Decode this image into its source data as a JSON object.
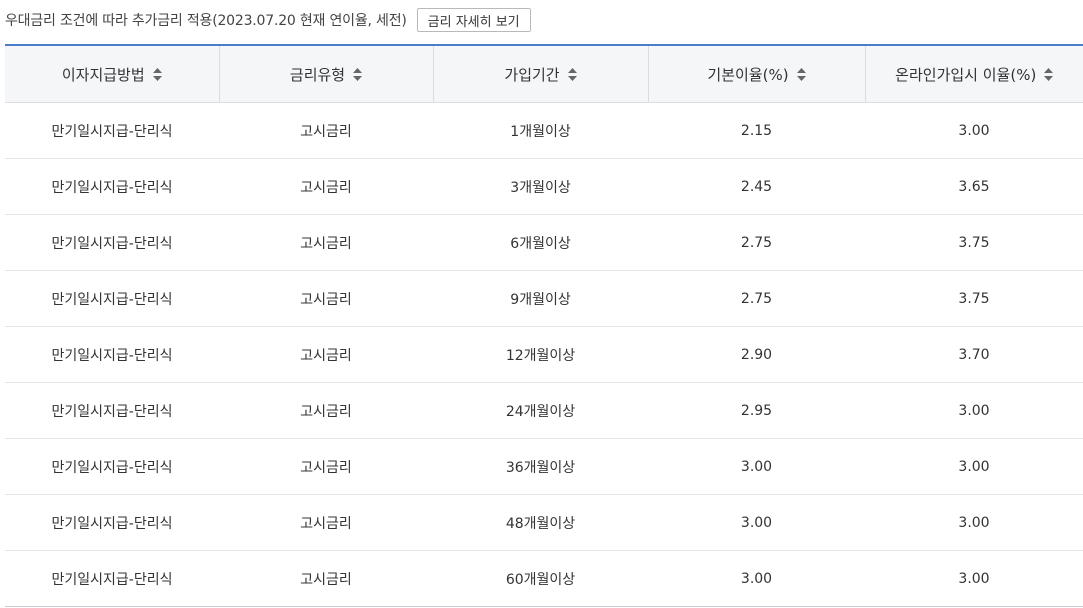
{
  "notice": {
    "text": "우대금리 조건에 따라 추가금리 적용(2023.07.20 현재 연이율, 세전)",
    "button_label": "금리 자세히 보기"
  },
  "table": {
    "columns": [
      {
        "label": "이자지급방법",
        "icon": "sort-icon"
      },
      {
        "label": "금리유형",
        "icon": "sort-icon"
      },
      {
        "label": "가입기간",
        "icon": "sort-icon"
      },
      {
        "label": "기본이율(%)",
        "icon": "sort-icon"
      },
      {
        "label": "온라인가입시 이율(%)",
        "icon": "sort-icon"
      }
    ],
    "rows": [
      [
        "만기일시지급-단리식",
        "고시금리",
        "1개월이상",
        "2.15",
        "3.00"
      ],
      [
        "만기일시지급-단리식",
        "고시금리",
        "3개월이상",
        "2.45",
        "3.65"
      ],
      [
        "만기일시지급-단리식",
        "고시금리",
        "6개월이상",
        "2.75",
        "3.75"
      ],
      [
        "만기일시지급-단리식",
        "고시금리",
        "9개월이상",
        "2.75",
        "3.75"
      ],
      [
        "만기일시지급-단리식",
        "고시금리",
        "12개월이상",
        "2.90",
        "3.70"
      ],
      [
        "만기일시지급-단리식",
        "고시금리",
        "24개월이상",
        "2.95",
        "3.00"
      ],
      [
        "만기일시지급-단리식",
        "고시금리",
        "36개월이상",
        "3.00",
        "3.00"
      ],
      [
        "만기일시지급-단리식",
        "고시금리",
        "48개월이상",
        "3.00",
        "3.00"
      ],
      [
        "만기일시지급-단리식",
        "고시금리",
        "60개월이상",
        "3.00",
        "3.00"
      ]
    ]
  },
  "colors": {
    "table_top_border": "#4a7cc9",
    "header_bg": "#f5f6f8",
    "sort_icon": "#666666"
  }
}
